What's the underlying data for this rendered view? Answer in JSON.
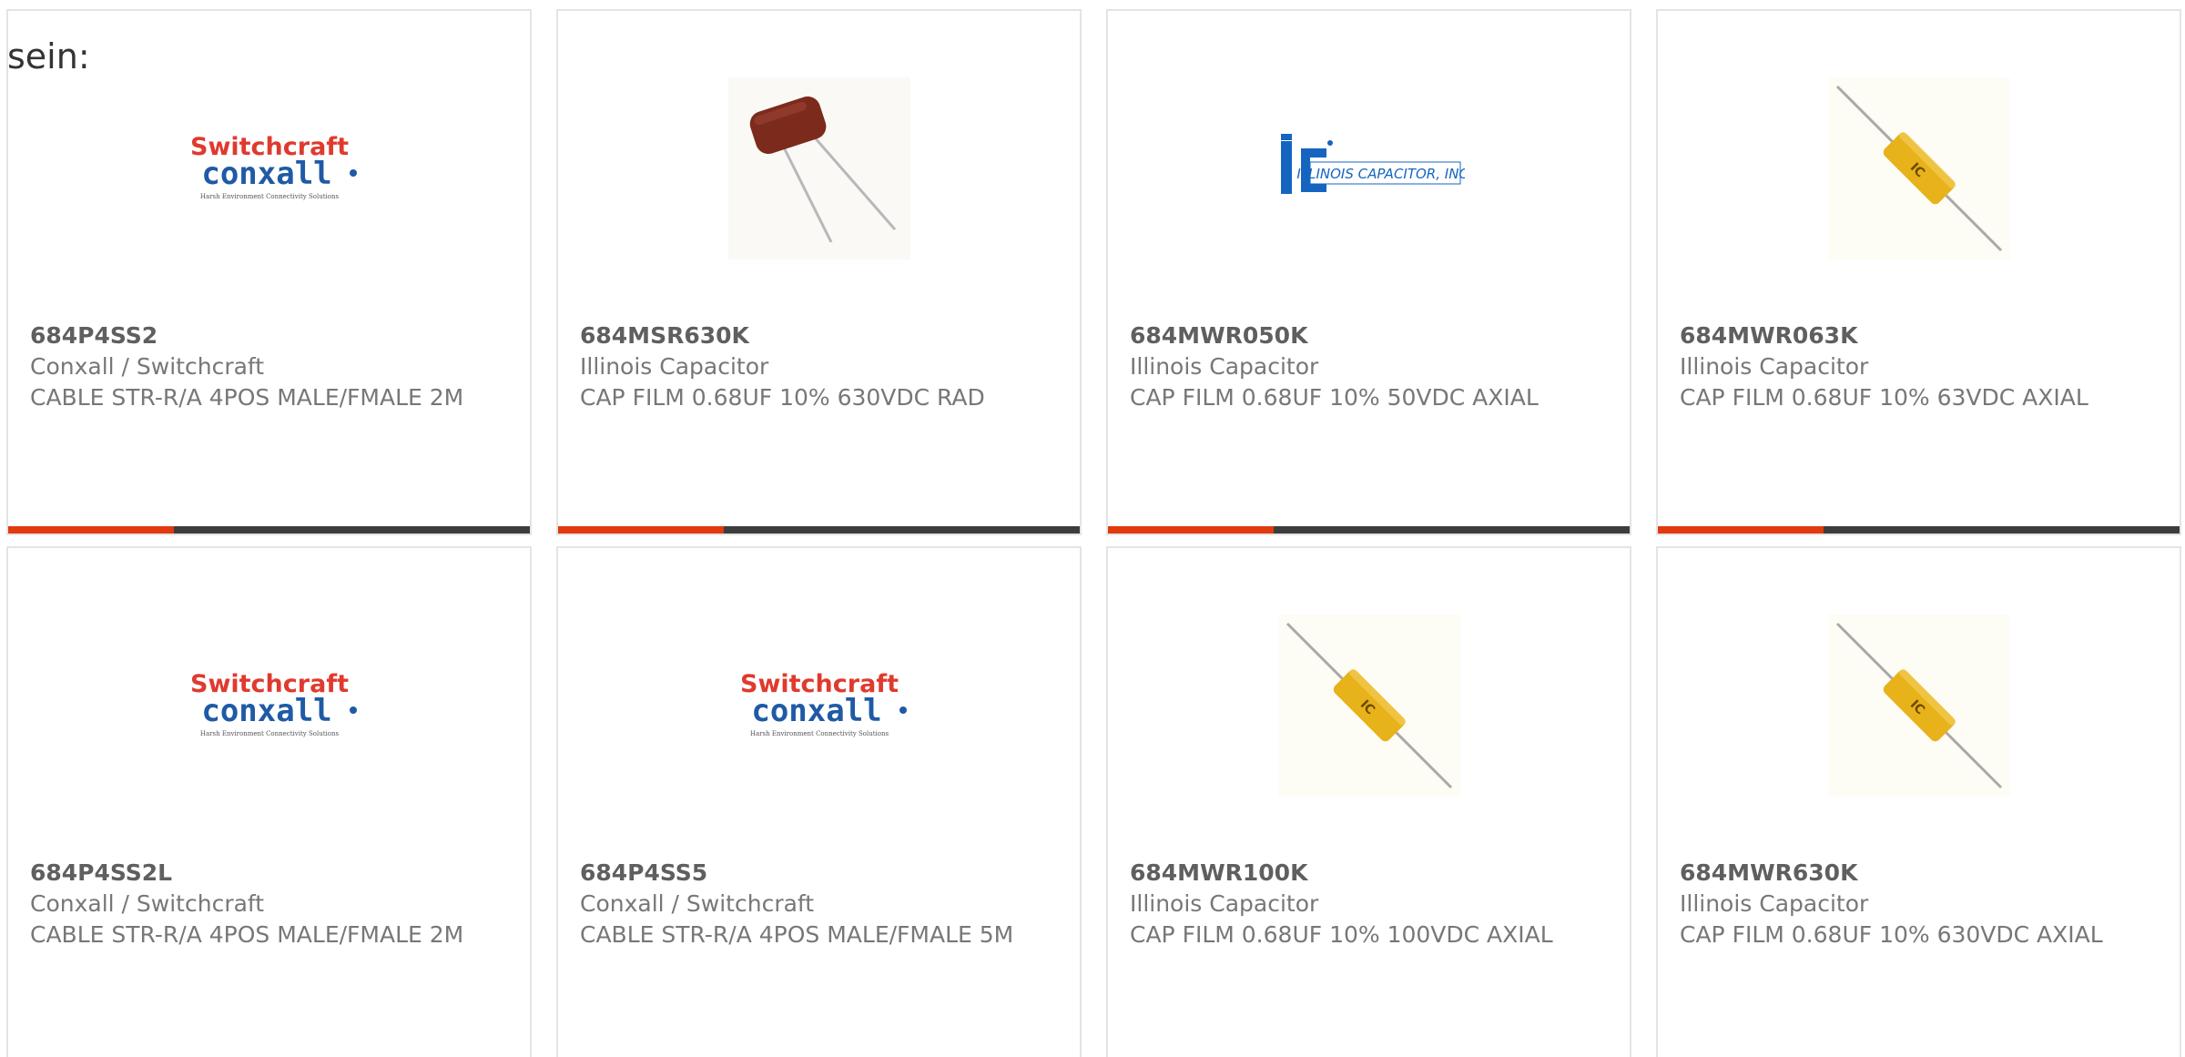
{
  "intro_text": "sein:",
  "colors": {
    "accent": "#e03a0e",
    "bar_dark": "#3d3d3d",
    "switchcraft_red": "#e03a2e",
    "conxall_blue": "#1f5aa6",
    "illinois_blue": "#1565c0",
    "capacitor_yellow": "#e8b21a",
    "capacitor_brown": "#7b2a1c"
  },
  "products": [
    {
      "part_number": "684P4SS2",
      "manufacturer": "Conxall / Switchcraft",
      "description": "CABLE STR-R/A 4POS MALE/FMALE 2M",
      "image": "switchcraft-conxall-logo",
      "logo_top": "Switchcraft",
      "logo_bottom": "conxall",
      "logo_tagline": "Harsh Environment Connectivity Solutions"
    },
    {
      "part_number": "684MSR630K",
      "manufacturer": "Illinois Capacitor",
      "description": "CAP FILM 0.68UF 10% 630VDC RAD",
      "image": "radial-film-capacitor-photo"
    },
    {
      "part_number": "684MWR050K",
      "manufacturer": "Illinois Capacitor",
      "description": "CAP FILM 0.68UF 10% 50VDC AXIAL",
      "image": "illinois-capacitor-logo",
      "logo_text": "ILLINOIS CAPACITOR, INC."
    },
    {
      "part_number": "684MWR063K",
      "manufacturer": "Illinois Capacitor",
      "description": "CAP FILM 0.68UF 10% 63VDC AXIAL",
      "image": "axial-film-capacitor-photo"
    },
    {
      "part_number": "684P4SS2L",
      "manufacturer": "Conxall / Switchcraft",
      "description": "CABLE STR-R/A 4POS MALE/FMALE 2M",
      "image": "switchcraft-conxall-logo",
      "logo_top": "Switchcraft",
      "logo_bottom": "conxall",
      "logo_tagline": "Harsh Environment Connectivity Solutions"
    },
    {
      "part_number": "684P4SS5",
      "manufacturer": "Conxall / Switchcraft",
      "description": "CABLE STR-R/A 4POS MALE/FMALE 5M",
      "image": "switchcraft-conxall-logo",
      "logo_top": "Switchcraft",
      "logo_bottom": "conxall",
      "logo_tagline": "Harsh Environment Connectivity Solutions"
    },
    {
      "part_number": "684MWR100K",
      "manufacturer": "Illinois Capacitor",
      "description": "CAP FILM 0.68UF 10% 100VDC AXIAL",
      "image": "axial-film-capacitor-photo"
    },
    {
      "part_number": "684MWR630K",
      "manufacturer": "Illinois Capacitor",
      "description": "CAP FILM 0.68UF 10% 630VDC AXIAL",
      "image": "axial-film-capacitor-photo"
    }
  ]
}
